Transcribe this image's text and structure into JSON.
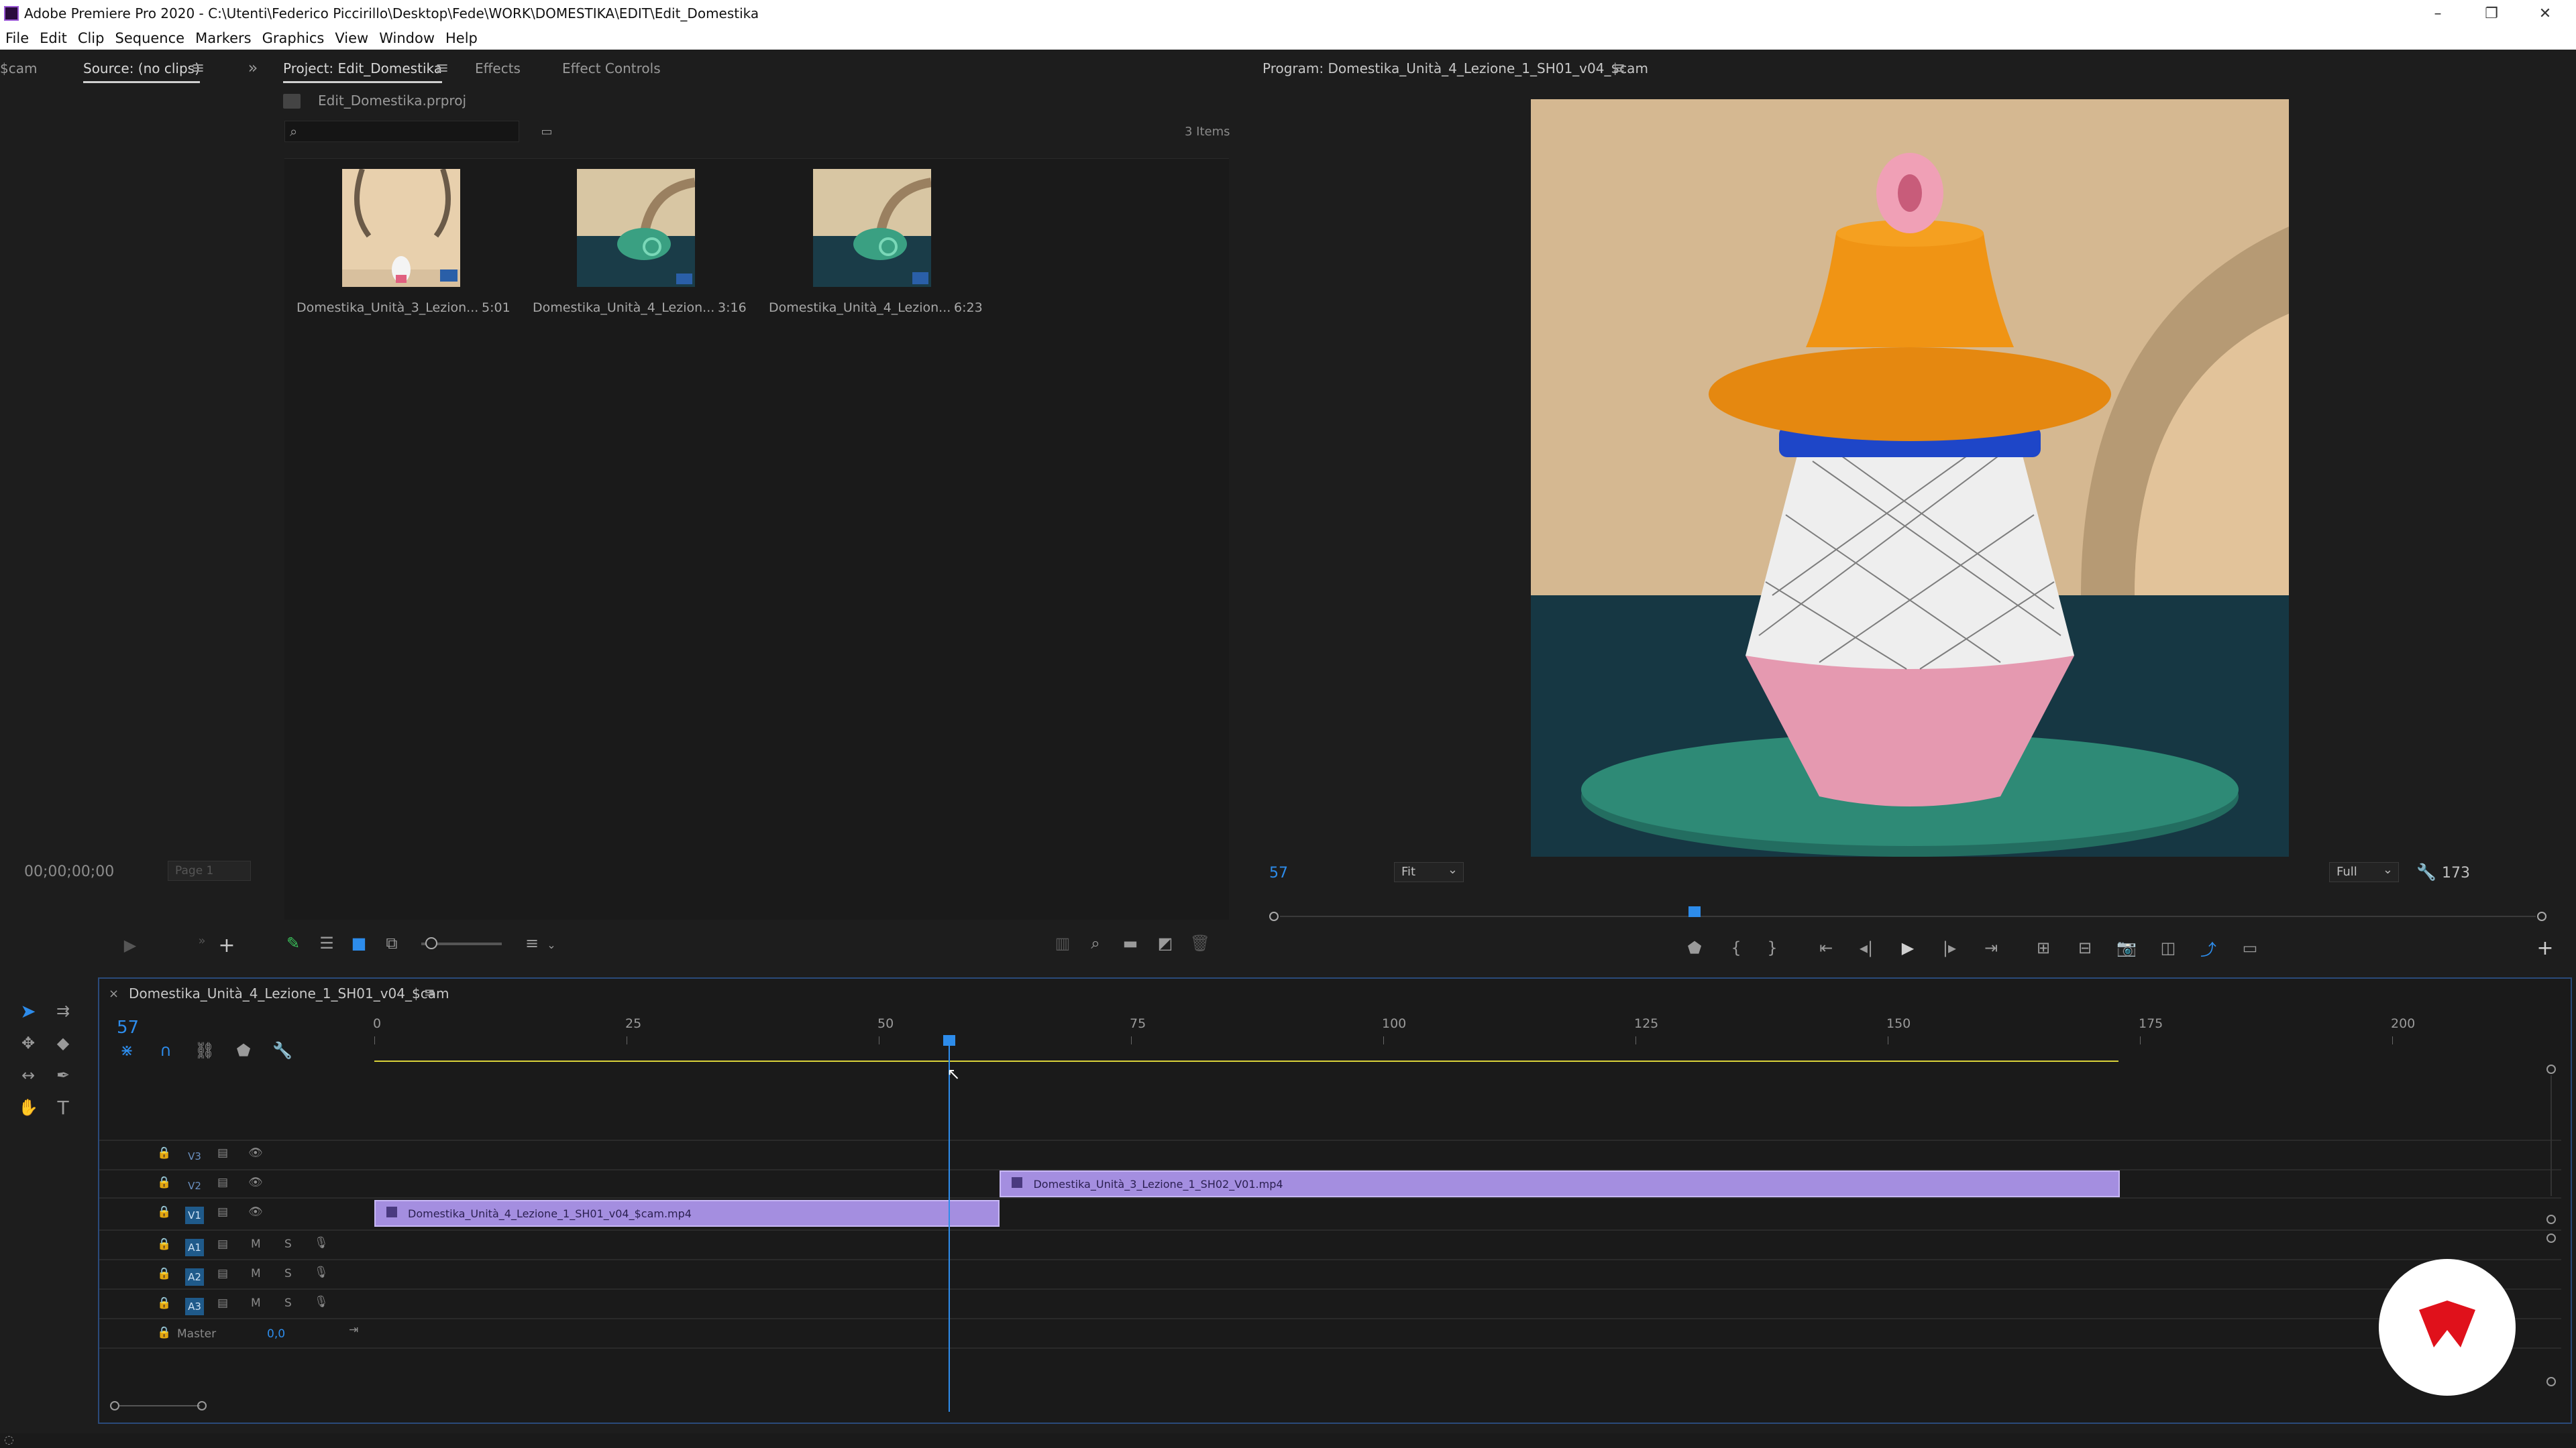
{
  "window": {
    "title": "Adobe Premiere Pro 2020 - C:\\Utenti\\Federico Piccirillo\\Desktop\\Fede\\WORK\\DOMESTIKA\\EDIT\\Edit_Domestika",
    "minimize": "–",
    "maximize": "❐",
    "close": "✕"
  },
  "menu": [
    "File",
    "Edit",
    "Clip",
    "Sequence",
    "Markers",
    "Graphics",
    "View",
    "Window",
    "Help"
  ],
  "source_panel": {
    "partial_tab": "$cam",
    "tab": "Source: (no clips)",
    "timecode": "00;00;00;00",
    "page": "Page 1"
  },
  "project_panel": {
    "tabs": [
      "Project: Edit_Domestika",
      "Effects",
      "Effect Controls"
    ],
    "file": "Edit_Domestika.prproj",
    "search_placeholder": "",
    "items_count": "3 Items",
    "items": [
      {
        "name": "Domestika_Unità_3_Lezion...",
        "duration": "5:01"
      },
      {
        "name": "Domestika_Unità_4_Lezion...",
        "duration": "3:16"
      },
      {
        "name": "Domestika_Unità_4_Lezion...",
        "duration": "6:23"
      }
    ]
  },
  "program_panel": {
    "tab": "Program: Domestika_Unità_4_Lezione_1_SH01_v04_$cam",
    "current_frame": "57",
    "zoom": "Fit",
    "resolution": "Full",
    "duration": "173",
    "playhead_fraction": 0.33
  },
  "timeline": {
    "sequence_name": "Domestika_Unità_4_Lezione_1_SH01_v04_$cam",
    "current_frame": "57",
    "ruler": [
      "0",
      "25",
      "50",
      "75",
      "100",
      "125",
      "150",
      "175",
      "200"
    ],
    "video_tracks": [
      "V3",
      "V2",
      "V1"
    ],
    "audio_tracks": [
      "A1",
      "A2",
      "A3"
    ],
    "audio_buttons": {
      "mute": "M",
      "solo": "S"
    },
    "master_label": "Master",
    "master_value": "0,0",
    "clips": [
      {
        "track": "V1",
        "name": "Domestika_Unità_4_Lezione_1_SH01_v04_$cam.mp4",
        "start": 0,
        "end": 62
      },
      {
        "track": "V2",
        "name": "Domestika_Unità_3_Lezione_1_SH02_V01.mp4",
        "start": 62,
        "end": 173
      }
    ],
    "playhead_frame": 57
  },
  "colors": {
    "accent_blue": "#2d8ceb",
    "clip_purple": "#a48ee0",
    "work_area_yellow": "#d9d23a",
    "brand_red": "#e0111b"
  }
}
